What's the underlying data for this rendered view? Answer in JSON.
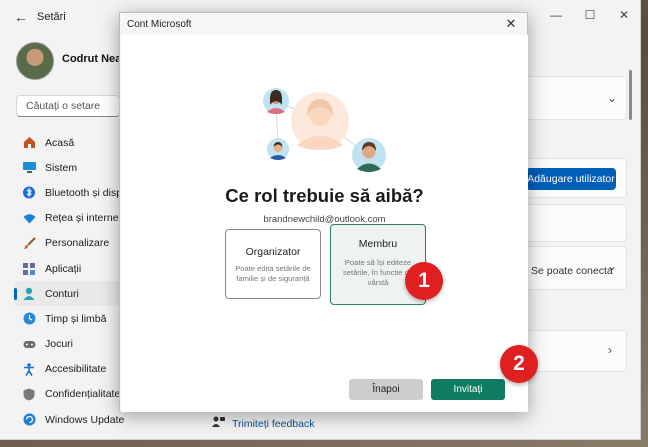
{
  "settings": {
    "title": "Setări",
    "user_name": "Codrut Neaqu",
    "search_placeholder": "Căutați o setare",
    "nav": [
      {
        "label": "Acasă",
        "icon": "home-icon"
      },
      {
        "label": "Sistem",
        "icon": "system-icon"
      },
      {
        "label": "Bluetooth și dispoz",
        "icon": "bluetooth-icon"
      },
      {
        "label": "Rețea și internet",
        "icon": "wifi-icon"
      },
      {
        "label": "Personalizare",
        "icon": "brush-icon"
      },
      {
        "label": "Aplicații",
        "icon": "apps-icon"
      },
      {
        "label": "Conturi",
        "icon": "account-icon",
        "active": true
      },
      {
        "label": "Timp și limbă",
        "icon": "globe-clock-icon"
      },
      {
        "label": "Jocuri",
        "icon": "gamepad-icon"
      },
      {
        "label": "Accesibilitate",
        "icon": "accessibility-icon"
      },
      {
        "label": "Confidențialitate și",
        "icon": "shield-icon"
      },
      {
        "label": "Windows Update",
        "icon": "update-icon"
      }
    ],
    "add_user_label": "Adăugare utilizator",
    "can_connect_label": "Se poate conecta",
    "feedback_label": "Trimiteți feedback"
  },
  "dialog": {
    "title": "Cont Microsoft",
    "heading": "Ce rol trebuie să aibă?",
    "email": "brandnewchild@outlook.com",
    "roles": [
      {
        "name": "Organizator",
        "description": "Poate edita setările de familie și de siguranță",
        "selected": false
      },
      {
        "name": "Membru",
        "description": "Poate să își editeze setările, în funcție de vârstă",
        "selected": true
      }
    ],
    "back_label": "Înapoi",
    "invite_label": "Invitați"
  },
  "markers": [
    {
      "label": "1"
    },
    {
      "label": "2"
    }
  ],
  "colors": {
    "accent_blue": "#005fb8",
    "invite_green": "#0f7b61",
    "marker_red": "#e02020"
  }
}
